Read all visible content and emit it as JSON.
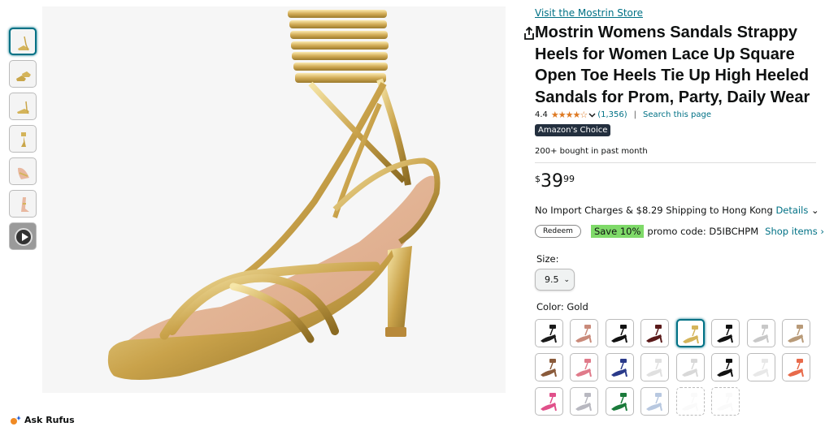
{
  "product": {
    "store_link": "Visit the Mostrin Store",
    "title": "Mostrin Womens Sandals Strappy Heels for Women Lace Up Square Open Toe Heels Tie Up High Heeled Sandals for Prom, Party, Daily Wear",
    "rating_value": "4.4",
    "stars": "★★★★☆",
    "rating_count": "(1,356)",
    "separator": "|",
    "search_page": "Search this page",
    "badge": "Amazon's Choice",
    "bought": "200+ bought in past month",
    "price": {
      "symbol": "$",
      "whole": "39",
      "fraction": "99"
    },
    "shipping": {
      "text": "No Import Charges & $8.29 Shipping to Hong Kong",
      "details": "Details",
      "chevron": "⌄"
    },
    "promo": {
      "redeem": "Redeem",
      "save": "Save 10%",
      "code": "promo code: D5IBCHPM",
      "shop_items": "Shop items ›"
    },
    "size": {
      "label": "Size:",
      "selected": "9.5",
      "chevron": "⌄"
    },
    "color": {
      "label": "Color: Gold"
    }
  },
  "ask_rufus": "Ask Rufus",
  "colors": {
    "gold": "#d4b45a",
    "link": "#007185",
    "star": "#de7921",
    "badge_bg": "#232f3e",
    "save_bg": "#7fda69"
  },
  "thumbnails": [
    {
      "name": "thumbnail-gold-side",
      "selected": true
    },
    {
      "name": "thumbnail-gold-pair"
    },
    {
      "name": "thumbnail-gold-back"
    },
    {
      "name": "thumbnail-gold-top"
    },
    {
      "name": "thumbnail-worn-foot"
    },
    {
      "name": "thumbnail-leg-view"
    },
    {
      "name": "thumbnail-video",
      "video": true
    }
  ],
  "swatch_colors": [
    [
      "#1a1a1a",
      "#c98a7a",
      "#111111",
      "#5a1a1a",
      "#d4b45a",
      "#111111",
      "#c8c8c8",
      "#b89a78"
    ],
    [
      "#8a5a3a",
      "#e07a8a",
      "#2a3a8a",
      "#e0e0e0",
      "#d8d8d8",
      "#111111",
      "#e8e8e8",
      "#e86a4a"
    ],
    [
      "#e0508a",
      "#b8b8c0",
      "#1a7a3a",
      "#b8c8e0",
      "#f0f0f0",
      "#f0f0f0"
    ]
  ]
}
